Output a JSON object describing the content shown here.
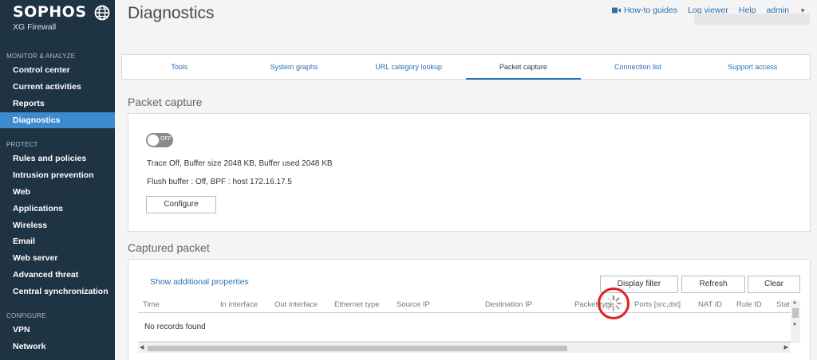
{
  "brand": {
    "name": "SOPHOS",
    "product": "XG Firewall"
  },
  "sidebar": {
    "sections": [
      {
        "title": "MONITOR & ANALYZE",
        "items": [
          "Control center",
          "Current activities",
          "Reports",
          "Diagnostics"
        ]
      },
      {
        "title": "PROTECT",
        "items": [
          "Rules and policies",
          "Intrusion prevention",
          "Web",
          "Applications",
          "Wireless",
          "Email",
          "Web server",
          "Advanced threat",
          "Central synchronization"
        ]
      },
      {
        "title": "CONFIGURE",
        "items": [
          "VPN",
          "Network"
        ]
      }
    ],
    "active_item": "Diagnostics"
  },
  "header": {
    "title": "Diagnostics",
    "links": {
      "howto": "How-to guides",
      "log_viewer": "Log viewer",
      "help": "Help",
      "user": "admin"
    }
  },
  "tabs": [
    "Tools",
    "System graphs",
    "URL category lookup",
    "Packet capture",
    "Connection list",
    "Support access"
  ],
  "active_tab": "Packet capture",
  "packet_capture": {
    "heading": "Packet capture",
    "toggle_label": "OFF",
    "trace_info": "Trace Off, Buffer size 2048 KB, Buffer used 2048 KB",
    "flush_info": "Flush buffer : Off, BPF : host 172.16.17.5",
    "configure_label": "Configure"
  },
  "captured": {
    "heading": "Captured packet",
    "show_props": "Show additional properties",
    "buttons": {
      "display_filter": "Display filter",
      "refresh": "Refresh",
      "clear": "Clear"
    },
    "columns": [
      "Time",
      "In interface",
      "Out interface",
      "Ethernet type",
      "Source IP",
      "Destination IP",
      "Packet type",
      "Ports [src,dst]",
      "NAT ID",
      "Rule ID",
      "Stat"
    ],
    "empty_text": "No records found"
  },
  "colors": {
    "sidebar_bg": "#1f3442",
    "active": "#3d8bcf",
    "link": "#2a6fae",
    "annotation": "#e02020"
  }
}
